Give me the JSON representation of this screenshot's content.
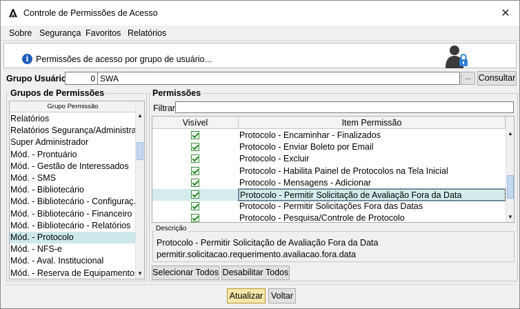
{
  "window": {
    "title": "Controle de Permissões de Acesso",
    "close_glyph": "✕"
  },
  "menu": [
    {
      "label": "Sobre"
    },
    {
      "label": "Segurança"
    },
    {
      "label": "Favoritos"
    },
    {
      "label": "Relatórios"
    }
  ],
  "info": {
    "icon": "info-icon",
    "text": "Permissões de acesso por grupo de usuário..."
  },
  "group": {
    "label": "Grupo Usuário:",
    "id_value": "0",
    "name_value": "SWA",
    "browse_label": "...",
    "consult_label": "Consultar"
  },
  "groups_panel": {
    "title": "Grupos de Permissões",
    "column_header": "Grupo Permissão",
    "items": [
      "Relatórios",
      "Relatórios Segurança/Administra...",
      "Super Administrador",
      "Mód. - Prontuário",
      "Mód. - Gestão de Interessados",
      "Mód. - SMS",
      "Mód. - Bibliotecário",
      "Mód. - Bibliotecário - Configuraç...",
      "Mód. - Bibliotecário - Financeiro",
      "Mód. - Bibliotecário - Relatórios",
      "Mód. - Protocolo",
      "Mód. - NFS-e",
      "Mód. - Aval. Institucional",
      "Mód. - Reserva de Equipamentos"
    ],
    "selected_index": 10
  },
  "permissions_panel": {
    "title": "Permissões",
    "filter_label": "Filtrar:",
    "filter_value": "",
    "columns": [
      "Visível",
      "Item Permissão"
    ],
    "rows": [
      {
        "visible": true,
        "item": "Protocolo - Encaminhar - Finalizados"
      },
      {
        "visible": true,
        "item": "Protocolo - Enviar Boleto por Email"
      },
      {
        "visible": true,
        "item": "Protocolo - Excluir"
      },
      {
        "visible": true,
        "item": "Protocolo - Habilita Painel de Protocolos na Tela Inicial"
      },
      {
        "visible": true,
        "item": "Protocolo - Mensagens - Adicionar"
      },
      {
        "visible": true,
        "item": "Protocolo - Permitir Solicitação de Avaliação Fora da Data"
      },
      {
        "visible": true,
        "item": "Protocolo - Permitir Solicitações Fora das Datas"
      },
      {
        "visible": true,
        "item": "Protocolo - Pesquisa/Controle de Protocolo"
      }
    ],
    "selected_index": 5,
    "description_title": "Descrição",
    "description_line1": "Protocolo - Permitir Solicitação de Avaliação Fora da Data",
    "description_line2": "permitir.solicitacao.requerimento.avaliacao.fora.data",
    "select_all_label": "Selecionar Todos",
    "disable_all_label": "Desabilitar Todos"
  },
  "footer": {
    "update_label": "Atualizar",
    "back_label": "Voltar"
  },
  "colors": {
    "selection": "#cde8ea",
    "accent": "#1e5bbd",
    "check": "#1e8a1e",
    "primary_button": "#f5e7a8"
  }
}
